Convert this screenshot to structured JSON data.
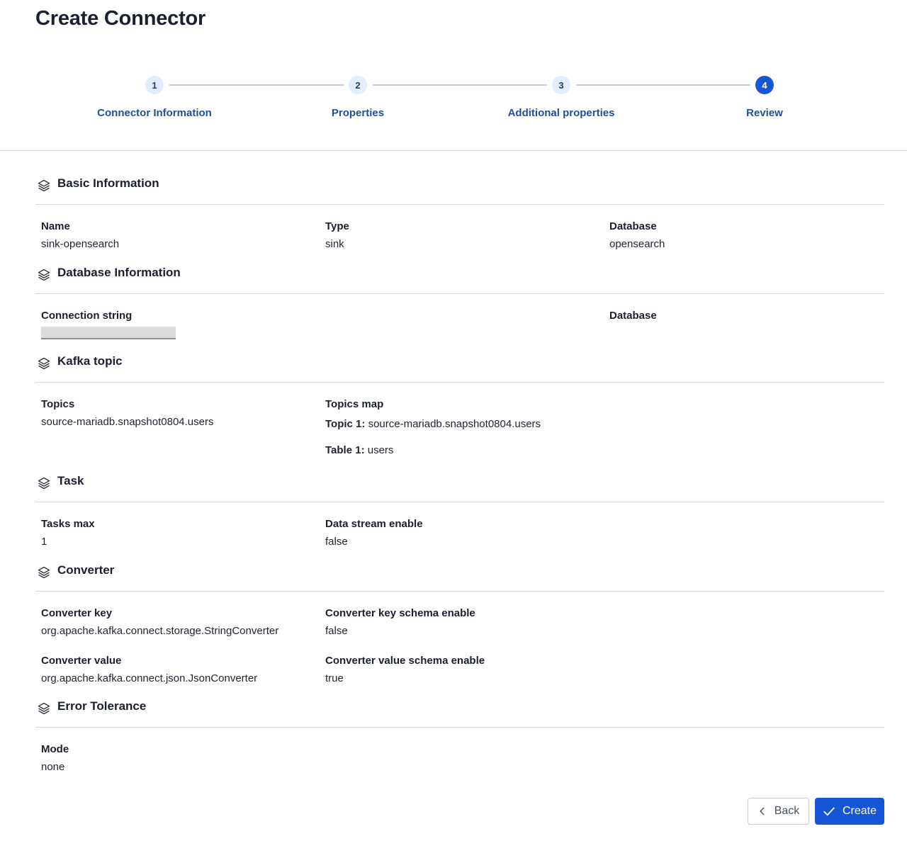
{
  "page": {
    "title": "Create Connector"
  },
  "stepper": {
    "steps": [
      {
        "number": "1",
        "label": "Connector Information",
        "active": false
      },
      {
        "number": "2",
        "label": "Properties",
        "active": false
      },
      {
        "number": "3",
        "label": "Additional properties",
        "active": false
      },
      {
        "number": "4",
        "label": "Review",
        "active": true
      }
    ]
  },
  "sections": {
    "basic": {
      "title": "Basic Information",
      "name_label": "Name",
      "name_value": "sink-opensearch",
      "type_label": "Type",
      "type_value": "sink",
      "database_label": "Database",
      "database_value": "opensearch"
    },
    "database": {
      "title": "Database Information",
      "connection_label": "Connection string",
      "database_label": "Database"
    },
    "kafka": {
      "title": "Kafka topic",
      "topics_label": "Topics",
      "topics_value": "source-mariadb.snapshot0804.users",
      "topics_map_label": "Topics map",
      "topic1_key": "Topic 1:",
      "topic1_value": "source-mariadb.snapshot0804.users",
      "table1_key": "Table 1:",
      "table1_value": "users"
    },
    "task": {
      "title": "Task",
      "tasks_max_label": "Tasks max",
      "tasks_max_value": "1",
      "data_stream_label": "Data stream enable",
      "data_stream_value": "false"
    },
    "converter": {
      "title": "Converter",
      "key_label": "Converter key",
      "key_value": "org.apache.kafka.connect.storage.StringConverter",
      "key_schema_label": "Converter key schema enable",
      "key_schema_value": "false",
      "value_label": "Converter value",
      "value_value": "org.apache.kafka.connect.json.JsonConverter",
      "value_schema_label": "Converter value schema enable",
      "value_schema_value": "true"
    },
    "error": {
      "title": "Error Tolerance",
      "mode_label": "Mode",
      "mode_value": "none"
    }
  },
  "actions": {
    "back_label": "Back",
    "create_label": "Create"
  },
  "colors": {
    "primary": "#1656d6",
    "step_label": "#1f4f9e",
    "divider": "#d6d9de"
  }
}
